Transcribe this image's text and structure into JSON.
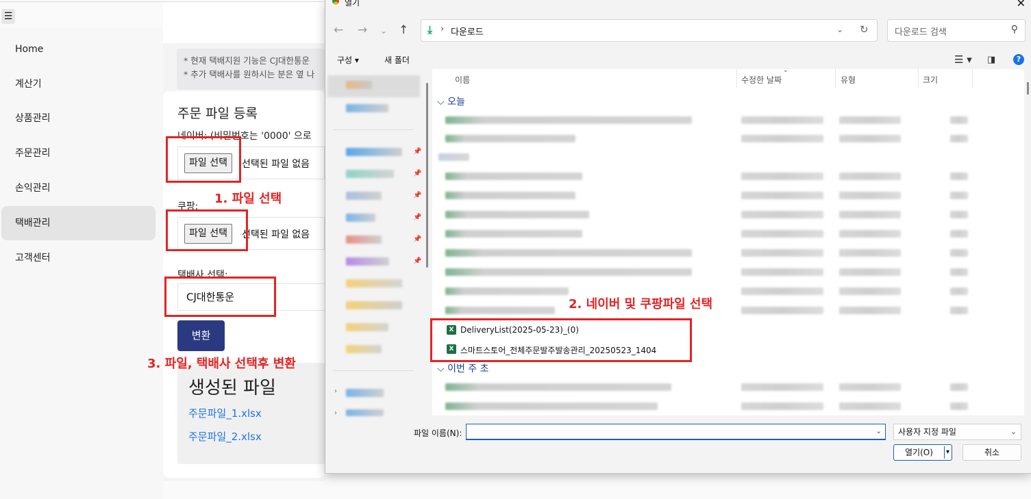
{
  "app": {
    "menu_icon": "hamburger-icon",
    "sidebar": {
      "items": [
        {
          "label": "Home",
          "active": false
        },
        {
          "label": "계산기",
          "active": false
        },
        {
          "label": "상품관리",
          "active": false
        },
        {
          "label": "주문관리",
          "active": false
        },
        {
          "label": "손익관리",
          "active": false
        },
        {
          "label": "택배관리",
          "active": true
        },
        {
          "label": "고객센터",
          "active": false
        }
      ]
    },
    "notice": {
      "line1": "* 현재 택배지원 기능은 CJ대한통운",
      "line2": "* 추가 택배사를 원하시는 분은 옆 나"
    },
    "section_title": "주문 파일 등록",
    "naver_label": "네이버: (비밀번호는 '0000' 으로",
    "coupang_label": "쿠팡:",
    "file_button_label": "파일 선택",
    "file_status": "선택된 파일 없음",
    "courier_label": "택배사 선택:",
    "courier_value": "CJ대한통운",
    "convert_button": "변환",
    "result_title": "생성된 파일",
    "result_files": [
      "주문파일_1.xlsx",
      "주문파일_2.xlsx"
    ]
  },
  "annotations": {
    "step1": "1.   파일 선택",
    "step2": "2. 네이버 및 쿠팡파일 선택",
    "step3": "3. 파일, 택배사 선택후 변환",
    "color": "#e52222"
  },
  "dialog": {
    "title": "열기",
    "address": "다운로드",
    "search_placeholder": "다운로드 검색",
    "toolbar": {
      "organize": "구성 ▾",
      "new_folder": "새 폴더"
    },
    "columns": {
      "name": "이름",
      "modified": "수정한 날짜",
      "type": "유형",
      "size": "크기"
    },
    "groups": {
      "today": "오늘",
      "this_week": "이번 주 초"
    },
    "visible_files": [
      "DeliveryList(2025-05-23)_(0)",
      "스마트스토어_전체주문발주발송관리_20250523_1404"
    ],
    "filename_label": "파일 이름(N):",
    "filename_value": "",
    "filetype_value": "사용자 지정 파일",
    "open_button": "열기(O)",
    "cancel_button": "취소"
  },
  "colors": {
    "accent_button": "#2b3a80",
    "link": "#1e73e8",
    "dialog_group_header": "#1a3e9a",
    "excel_icon": "#1d7044"
  }
}
